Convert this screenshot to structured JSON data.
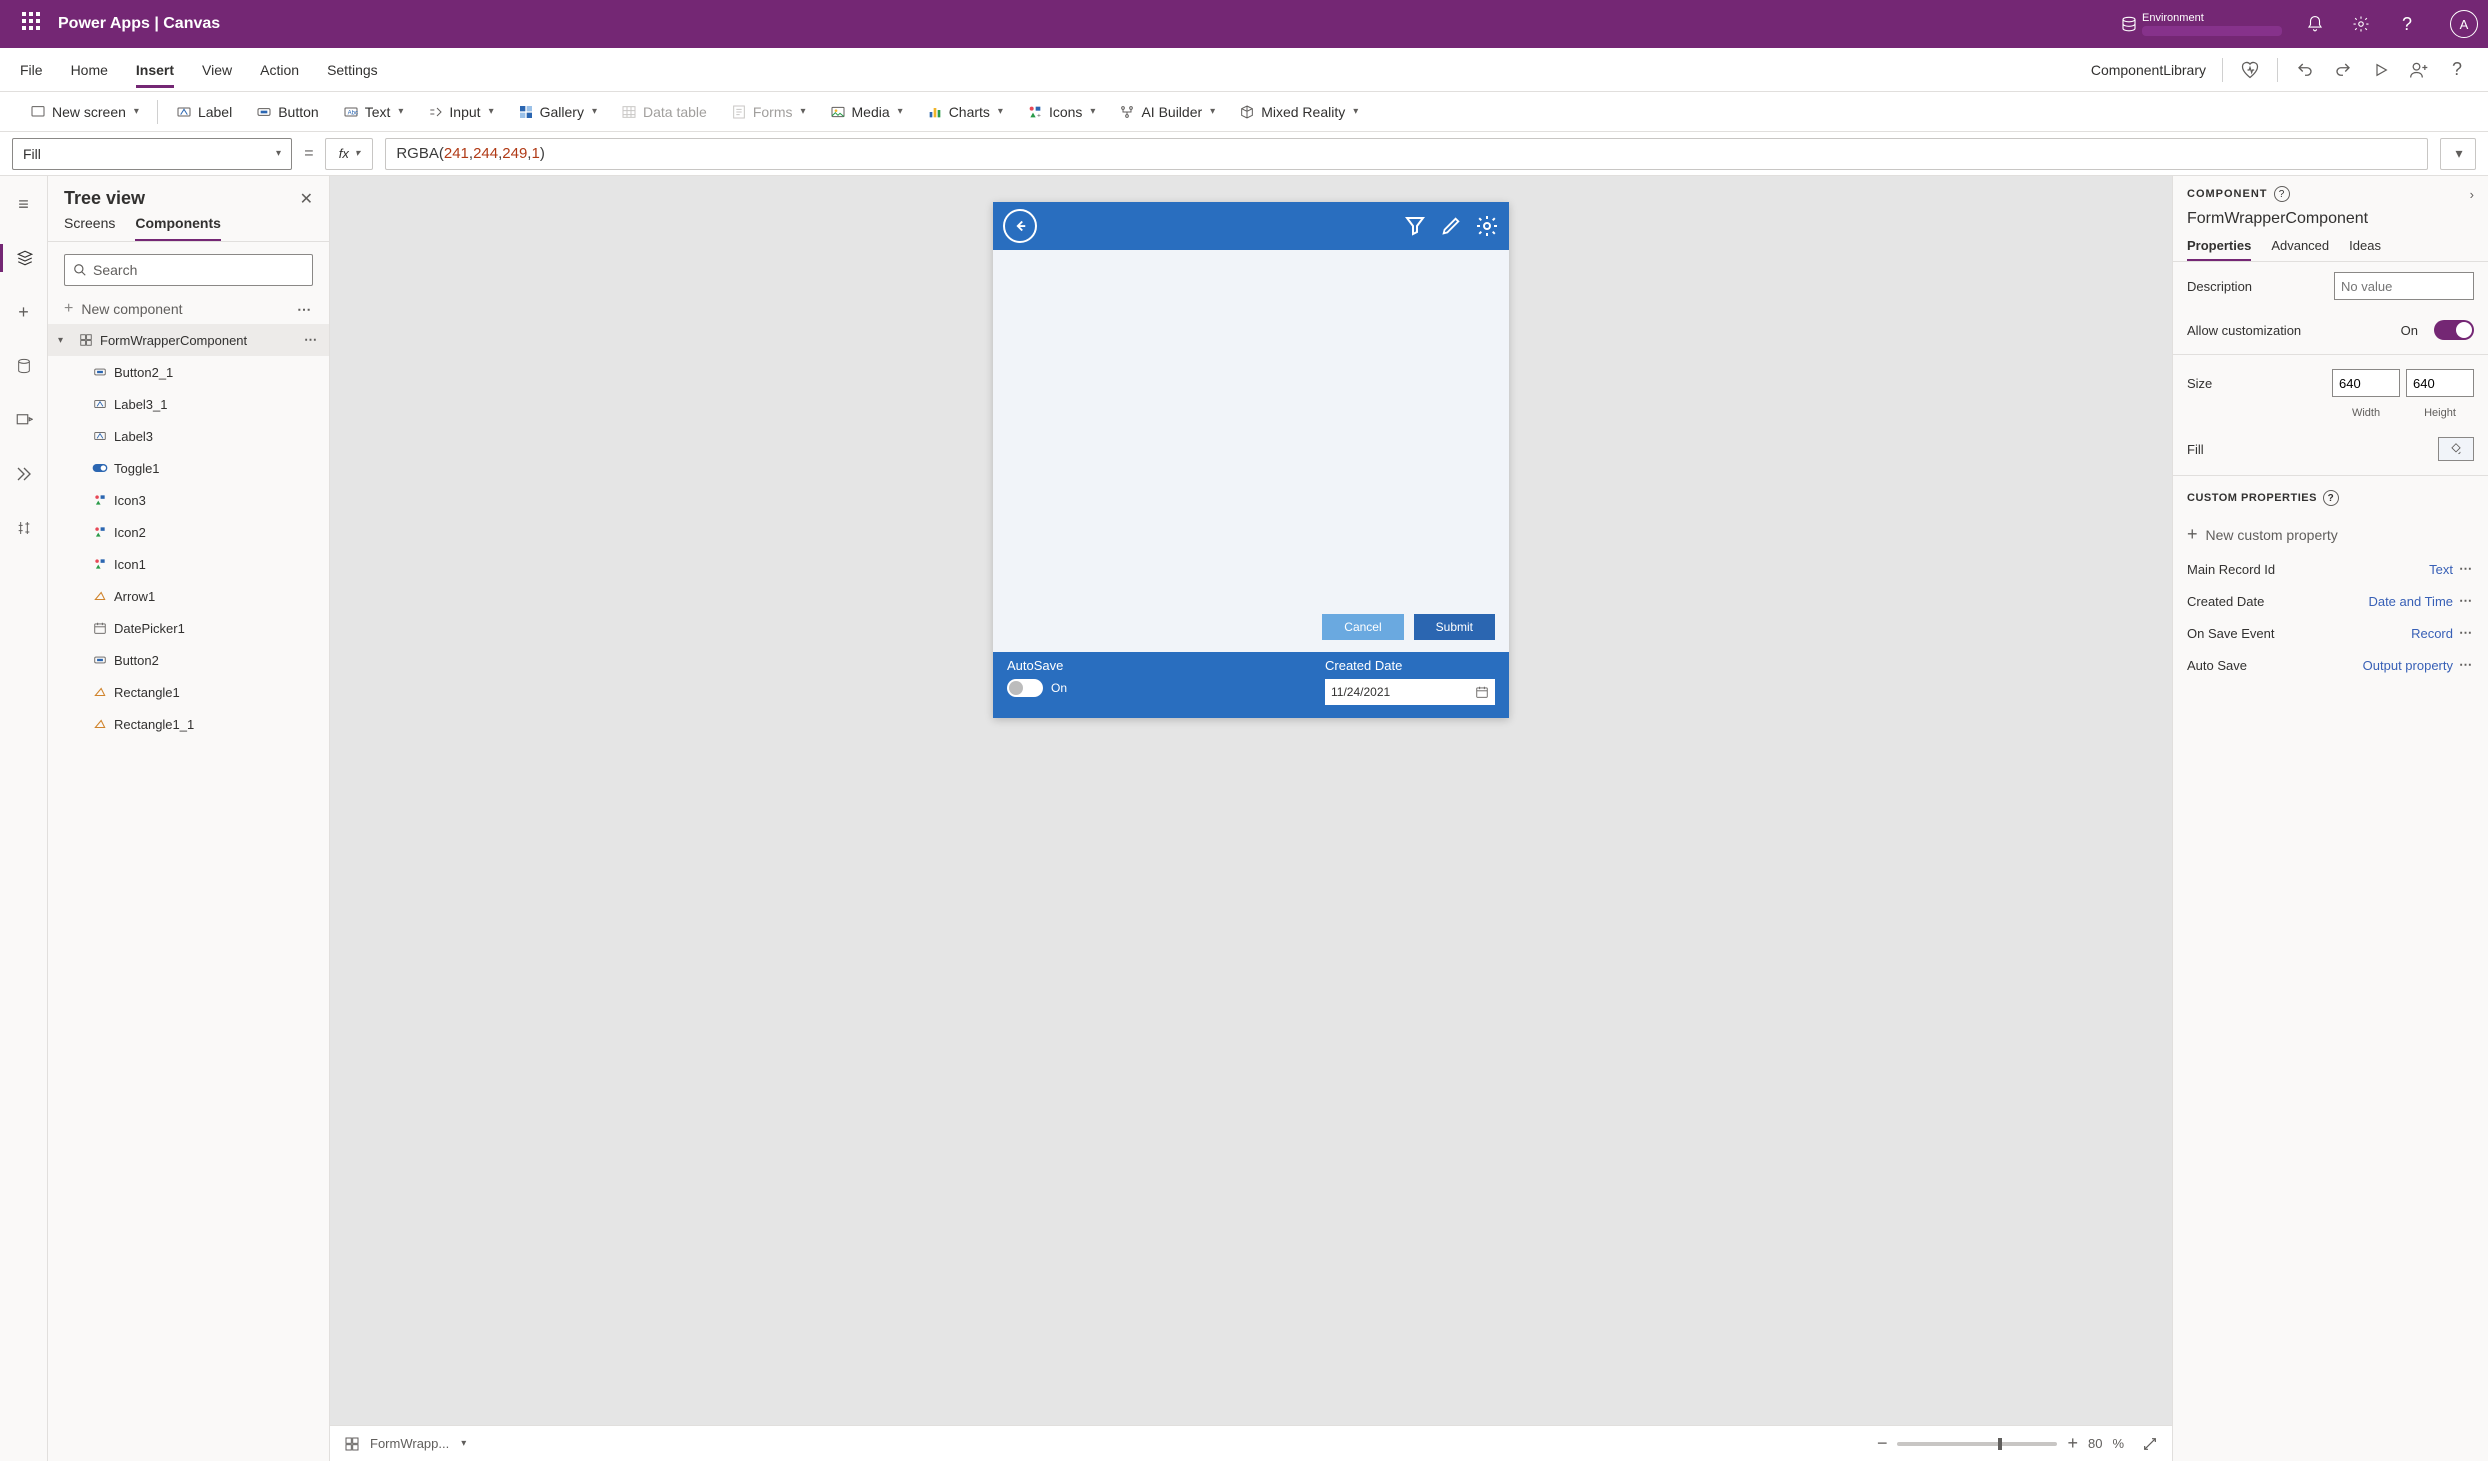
{
  "header": {
    "app_title": "Power Apps  |  Canvas",
    "env_label": "Environment",
    "avatar_letter": "A"
  },
  "menubar": {
    "items": [
      "File",
      "Home",
      "Insert",
      "View",
      "Action",
      "Settings"
    ],
    "active": "Insert",
    "component_library": "ComponentLibrary"
  },
  "ribbon": {
    "new_screen": "New screen",
    "label": "Label",
    "button": "Button",
    "text": "Text",
    "input": "Input",
    "gallery": "Gallery",
    "data_table": "Data table",
    "forms": "Forms",
    "media": "Media",
    "charts": "Charts",
    "icons": "Icons",
    "ai_builder": "AI Builder",
    "mixed_reality": "Mixed Reality"
  },
  "formula": {
    "property": "Fill",
    "expression_display": "RGBA(241, 244, 249, 1)"
  },
  "tree": {
    "title": "Tree view",
    "tabs": [
      "Screens",
      "Components"
    ],
    "active_tab": "Components",
    "search_placeholder": "Search",
    "new_component": "New component",
    "root": "FormWrapperComponent",
    "children": [
      {
        "icon": "button",
        "label": "Button2_1"
      },
      {
        "icon": "label",
        "label": "Label3_1"
      },
      {
        "icon": "label",
        "label": "Label3"
      },
      {
        "icon": "toggle",
        "label": "Toggle1"
      },
      {
        "icon": "icons",
        "label": "Icon3"
      },
      {
        "icon": "icons",
        "label": "Icon2"
      },
      {
        "icon": "icons",
        "label": "Icon1"
      },
      {
        "icon": "shape",
        "label": "Arrow1"
      },
      {
        "icon": "date",
        "label": "DatePicker1"
      },
      {
        "icon": "button",
        "label": "Button2"
      },
      {
        "icon": "shape",
        "label": "Rectangle1"
      },
      {
        "icon": "shape",
        "label": "Rectangle1_1"
      }
    ]
  },
  "canvas": {
    "cancel": "Cancel",
    "submit": "Submit",
    "autosave_label": "AutoSave",
    "toggle_text": "On",
    "created_label": "Created Date",
    "date_value": "11/24/2021",
    "selector_name": "FormWrapp...",
    "zoom": "80",
    "zoom_suffix": "%"
  },
  "props": {
    "header": "COMPONENT",
    "title": "FormWrapperComponent",
    "tabs": [
      "Properties",
      "Advanced",
      "Ideas"
    ],
    "active_tab": "Properties",
    "description_label": "Description",
    "description_placeholder": "No value",
    "allow_custom_label": "Allow customization",
    "allow_custom_value": "On",
    "size_label": "Size",
    "width": "640",
    "height": "640",
    "width_label": "Width",
    "height_label": "Height",
    "fill_label": "Fill",
    "custom_section": "CUSTOM PROPERTIES",
    "new_custom_property": "New custom property",
    "custom": [
      {
        "name": "Main Record Id",
        "type": "Text"
      },
      {
        "name": "Created Date",
        "type": "Date and Time"
      },
      {
        "name": "On Save Event",
        "type": "Record"
      },
      {
        "name": "Auto Save",
        "type": "Output property"
      }
    ]
  }
}
